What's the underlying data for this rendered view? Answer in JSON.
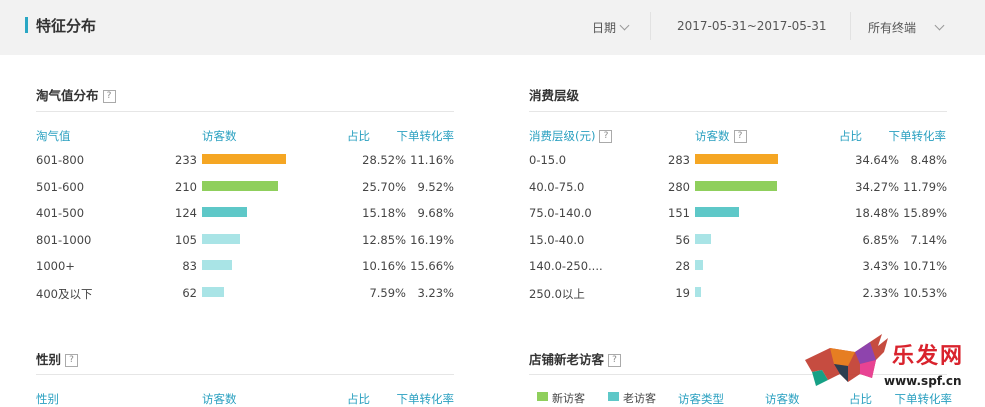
{
  "header": {
    "title": "特征分布",
    "date_label": "日期",
    "date_range": "2017-05-31~2017-05-31",
    "terminal": "所有终端"
  },
  "taoqi": {
    "title": "淘气值分布",
    "cols": [
      "淘气值",
      "访客数",
      "占比",
      "下单转化率"
    ],
    "rows": [
      {
        "label": "601-800",
        "visitors": "233",
        "share": "28.52%",
        "conv": "11.16%",
        "fraction": 0.2852,
        "color": "#f5a623"
      },
      {
        "label": "501-600",
        "visitors": "210",
        "share": "25.70%",
        "conv": "9.52%",
        "fraction": 0.257,
        "color": "#8fcf5c"
      },
      {
        "label": "401-500",
        "visitors": "124",
        "share": "15.18%",
        "conv": "9.68%",
        "fraction": 0.1518,
        "color": "#5ec8c8"
      },
      {
        "label": "801-1000",
        "visitors": "105",
        "share": "12.85%",
        "conv": "16.19%",
        "fraction": 0.1285,
        "color": "#a9e4e6"
      },
      {
        "label": "1000+",
        "visitors": "83",
        "share": "10.16%",
        "conv": "15.66%",
        "fraction": 0.1016,
        "color": "#a9e4e6"
      },
      {
        "label": "400及以下",
        "visitors": "62",
        "share": "7.59%",
        "conv": "3.23%",
        "fraction": 0.0759,
        "color": "#a9e4e6"
      }
    ]
  },
  "consume": {
    "title": "消费层级",
    "cols": [
      "消费层级(元)",
      "访客数",
      "占比",
      "下单转化率"
    ],
    "rows": [
      {
        "label": "0-15.0",
        "visitors": "283",
        "share": "34.64%",
        "conv": "8.48%",
        "fraction": 0.3464,
        "color": "#f5a623"
      },
      {
        "label": "40.0-75.0",
        "visitors": "280",
        "share": "34.27%",
        "conv": "11.79%",
        "fraction": 0.3427,
        "color": "#8fcf5c"
      },
      {
        "label": "75.0-140.0",
        "visitors": "151",
        "share": "18.48%",
        "conv": "15.89%",
        "fraction": 0.1848,
        "color": "#5ec8c8"
      },
      {
        "label": "15.0-40.0",
        "visitors": "56",
        "share": "6.85%",
        "conv": "7.14%",
        "fraction": 0.0685,
        "color": "#a9e4e6"
      },
      {
        "label": "140.0-250....",
        "visitors": "28",
        "share": "3.43%",
        "conv": "10.71%",
        "fraction": 0.0343,
        "color": "#a9e4e6"
      },
      {
        "label": "250.0以上",
        "visitors": "19",
        "share": "2.33%",
        "conv": "10.53%",
        "fraction": 0.0233,
        "color": "#a9e4e6"
      }
    ]
  },
  "gender": {
    "title": "性别",
    "cols": [
      "性别",
      "访客数",
      "占比",
      "下单转化率"
    ]
  },
  "visitors_type": {
    "title": "店铺新老访客",
    "legend_new": "新访客",
    "legend_old": "老访客",
    "cols": [
      "访客类型",
      "访客数",
      "占比",
      "下单转化率"
    ]
  },
  "watermark": {
    "brand": "乐发网",
    "url": "www.spf.cn"
  }
}
